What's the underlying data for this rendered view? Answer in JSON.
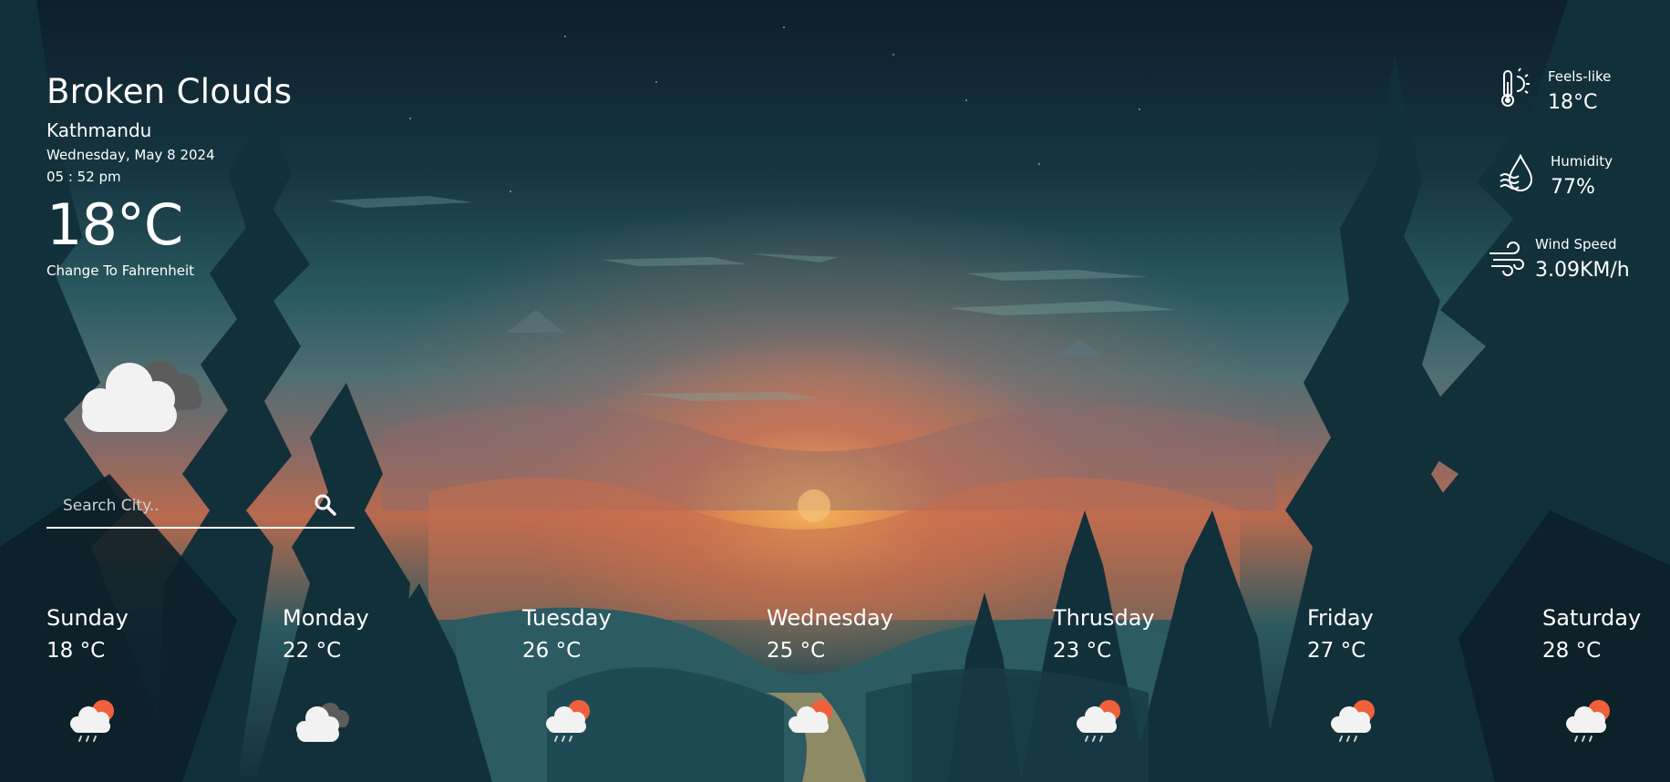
{
  "current": {
    "condition": "Broken Clouds",
    "city": "Kathmandu",
    "date": "Wednesday, May 8 2024",
    "time": "05 : 52 pm",
    "temperature": "18°C",
    "unit_toggle": "Change To Fahrenheit",
    "icon": "broken-clouds-icon"
  },
  "search": {
    "placeholder": "Search City..",
    "value": "",
    "button_icon": "search-icon"
  },
  "stats": [
    {
      "label": "Feels-like",
      "value": "18°C",
      "icon": "thermometer-sun-icon"
    },
    {
      "label": "Humidity",
      "value": "77%",
      "icon": "humidity-drop-icon"
    },
    {
      "label": "Wind Speed",
      "value": "3.09KM/h",
      "icon": "wind-icon"
    }
  ],
  "forecast": [
    {
      "day": "Sunday",
      "temp": "18 °C",
      "icon": "sun-cloud-rain-icon"
    },
    {
      "day": "Monday",
      "temp": "22 °C",
      "icon": "broken-clouds-icon"
    },
    {
      "day": "Tuesday",
      "temp": "26 °C",
      "icon": "sun-cloud-rain-icon"
    },
    {
      "day": "Wednesday",
      "temp": "25 °C",
      "icon": "sun-cloud-icon"
    },
    {
      "day": "Thrusday",
      "temp": "23 °C",
      "icon": "sun-cloud-rain-icon"
    },
    {
      "day": "Friday",
      "temp": "27 °C",
      "icon": "sun-cloud-rain-icon"
    },
    {
      "day": "Saturday",
      "temp": "28 °C",
      "icon": "sun-cloud-rain-icon"
    }
  ],
  "colors": {
    "text": "#ffffff",
    "sun": "#f0603c",
    "cloud": "#f2f2f2",
    "dark_cloud": "#5c5c5c"
  }
}
